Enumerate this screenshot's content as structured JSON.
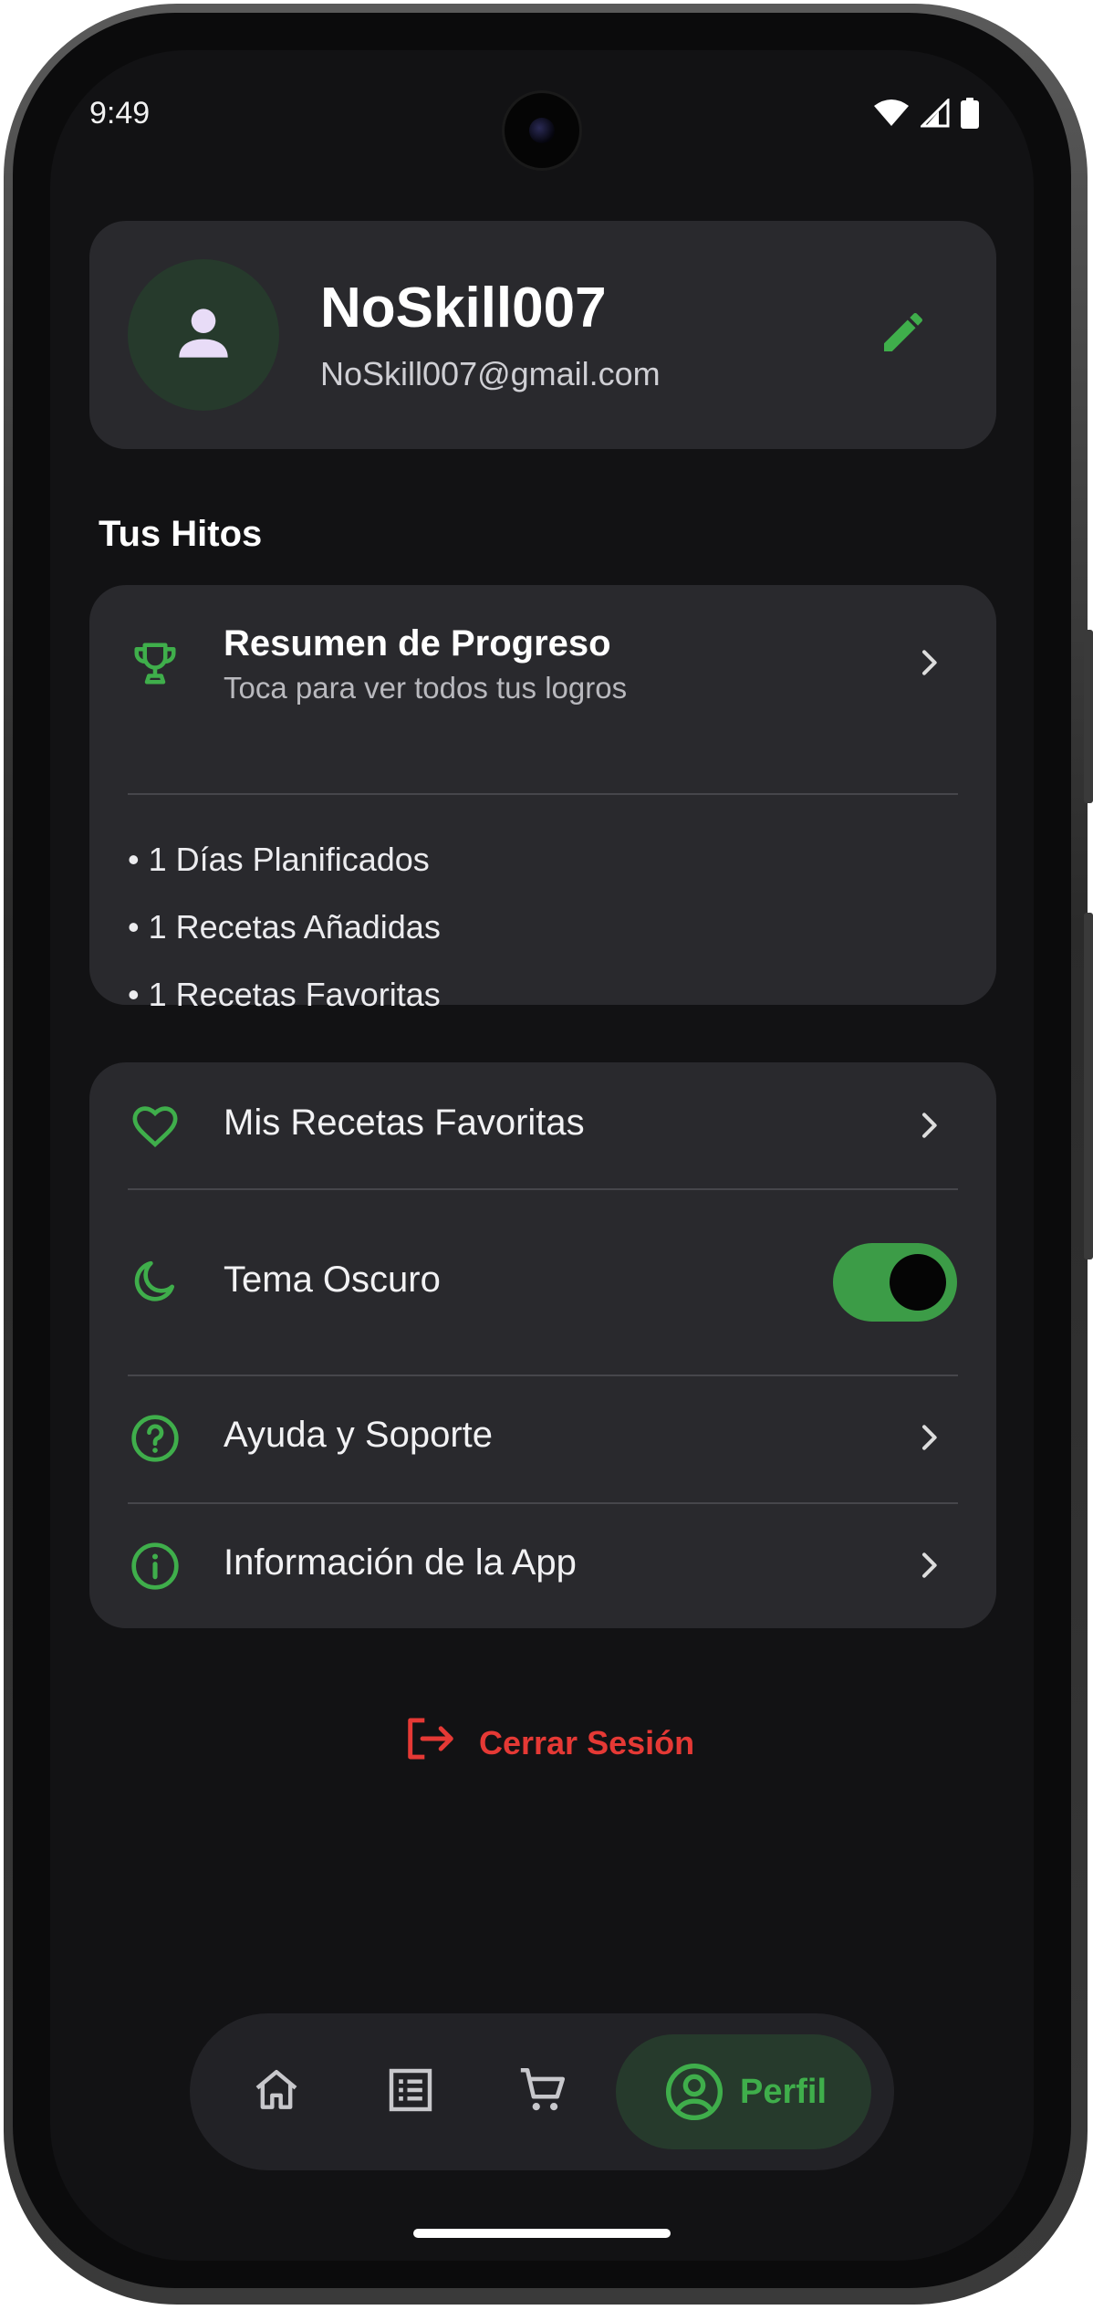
{
  "status_bar": {
    "time": "9:49",
    "icons": [
      "wifi-icon",
      "signal-icon",
      "battery-icon"
    ]
  },
  "profile": {
    "username": "NoSkill007",
    "email": "NoSkill007@gmail.com",
    "avatar_icon": "person-icon",
    "edit_icon": "pencil-icon"
  },
  "milestones": {
    "section_title": "Tus Hitos",
    "card_title": "Resumen de Progreso",
    "card_subtitle": "Toca para ver todos tus logros",
    "icon": "trophy-icon",
    "items": [
      "• 1 Días Planificados",
      "• 1 Recetas Añadidas",
      "• 1 Recetas Favoritas"
    ]
  },
  "settings": {
    "items": [
      {
        "label": "Mis Recetas Favoritas",
        "icon": "heart-icon"
      },
      {
        "label": "Tema Oscuro",
        "icon": "moon-icon",
        "toggle_on": true
      },
      {
        "label": "Ayuda y Soporte",
        "icon": "help-circle-icon"
      },
      {
        "label": "Información de la App",
        "icon": "info-icon"
      }
    ]
  },
  "logout": {
    "label": "Cerrar Sesión",
    "icon": "logout-icon"
  },
  "bottom_nav": {
    "items": [
      {
        "icon": "home-icon"
      },
      {
        "icon": "list-icon"
      },
      {
        "icon": "cart-icon"
      },
      {
        "icon": "profile-icon",
        "label": "Perfil",
        "active": true
      }
    ]
  },
  "colors": {
    "accent": "#3fae4b",
    "danger": "#e53935",
    "background": "#121214",
    "card": "#29292d"
  }
}
